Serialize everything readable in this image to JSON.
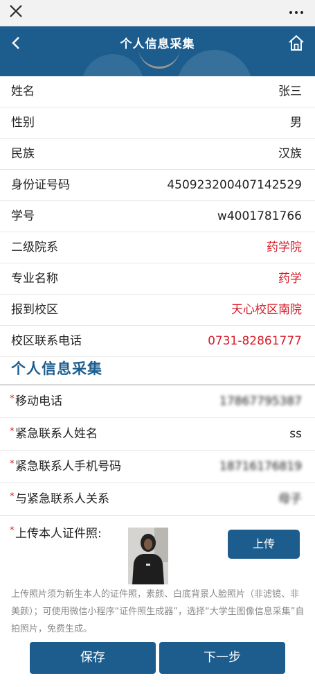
{
  "topbar": {
    "close_icon": "close-icon",
    "more_icon": "more-icon"
  },
  "header": {
    "title": "个人信息采集",
    "back_icon": "chevron-left-icon",
    "home_icon": "home-icon"
  },
  "info": [
    {
      "label": "姓名",
      "value": "张三",
      "highlight": false
    },
    {
      "label": "性别",
      "value": "男",
      "highlight": false
    },
    {
      "label": "民族",
      "value": "汉族",
      "highlight": false
    },
    {
      "label": "身份证号码",
      "value": "450923200407142529",
      "highlight": false
    },
    {
      "label": "学号",
      "value": "w4001781766",
      "highlight": false
    },
    {
      "label": "二级院系",
      "value": "药学院",
      "highlight": true
    },
    {
      "label": "专业名称",
      "value": "药学",
      "highlight": true
    },
    {
      "label": "报到校区",
      "value": "天心校区南院",
      "highlight": true
    },
    {
      "label": "校区联系电话",
      "value": "0731-82861777",
      "highlight": true
    }
  ],
  "section_title": "个人信息采集",
  "form": [
    {
      "label": "移动电话",
      "value": "17867795387",
      "blurred": true
    },
    {
      "label": "紧急联系人姓名",
      "value": "ss",
      "blurred": false
    },
    {
      "label": "紧急联系人手机号码",
      "value": "18716176819",
      "blurred": true
    },
    {
      "label": "与紧急联系人关系",
      "value": "母子",
      "blurred": true
    }
  ],
  "required_mark": "*",
  "upload": {
    "label": "上传本人证件照:",
    "button": "上传"
  },
  "notice": "上传照片须为新生本人的证件照，素颜、白底背景人脸照片（非滤镜、非美颜）；可使用微信小程序“证件照生成器”，选择“大学生图像信息采集”自拍照片，免费生成。",
  "buttons": {
    "save": "保存",
    "next": "下一步"
  },
  "colors": {
    "primary": "#1c5d8e",
    "highlight": "#d81e2a"
  }
}
